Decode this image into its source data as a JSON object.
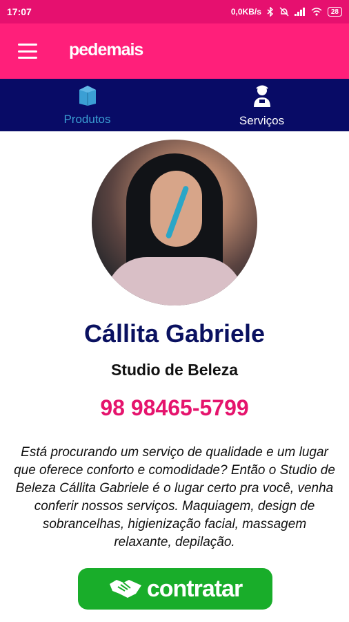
{
  "status_bar": {
    "time": "17:07",
    "network_speed": "0,0KB/s",
    "battery": "28"
  },
  "app_bar": {
    "brand": "pedemais",
    "menu_icon": "hamburger-menu-icon"
  },
  "tabs": [
    {
      "label": "Produtos",
      "icon": "shopping-bag-icon",
      "color": "#3b9fd4"
    },
    {
      "label": "Serviços",
      "icon": "service-person-icon",
      "color": "#ffffff"
    }
  ],
  "profile": {
    "name": "Cállita Gabriele",
    "subtitle": "Studio de Beleza",
    "phone": "98 98465-5799",
    "description": "Está procurando um serviço de qualidade e um lugar que oferece conforto e comodidade? Então o Studio de Beleza Cállita Gabriele é o lugar certo pra você, venha conferir nossos serviços. Maquiagem, design de sobrancelhas, higienização facial, massagem relaxante, depilação.",
    "avatar_icon": "profile-photo"
  },
  "cta": {
    "label": "contratar",
    "icon": "handshake-icon"
  },
  "colors": {
    "status_bar": "#e6106f",
    "app_bar": "#ff1f7a",
    "tab_bar": "#080b66",
    "name": "#0a1160",
    "phone": "#e5146d",
    "button": "#19ad2a"
  }
}
